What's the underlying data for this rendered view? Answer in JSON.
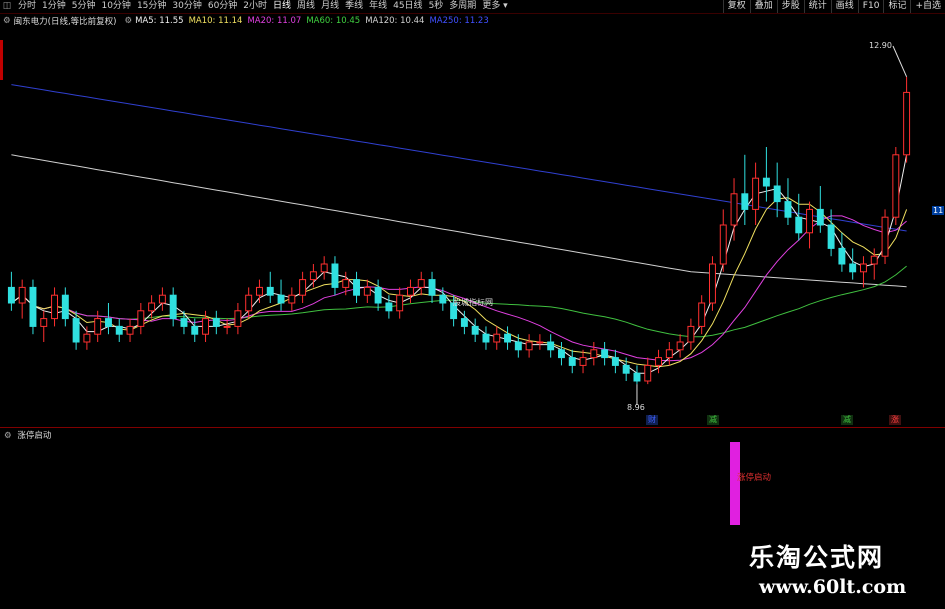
{
  "toolbar": {
    "icon": "chart-toggle-icon",
    "timeframes": [
      "分时",
      "1分钟",
      "5分钟",
      "10分钟",
      "15分钟",
      "30分钟",
      "60分钟",
      "2小时",
      "日线",
      "周线",
      "月线",
      "季线",
      "年线",
      "45日线",
      "5秒",
      "多周期",
      "更多"
    ],
    "active_index": 8,
    "right_buttons": [
      "复权",
      "叠加",
      "步股",
      "统计",
      "画线",
      "F10",
      "标记",
      "+自选"
    ]
  },
  "legend": {
    "title": "闽东电力(日线,等比前复权)",
    "ma5": "MA5: 11.55",
    "ma10": "MA10: 11.14",
    "ma20": "MA20: 11.07",
    "ma60": "MA60: 10.45",
    "ma120": "MA120: 10.44",
    "ma250": "MA250: 11.23"
  },
  "labels": {
    "high_price": "12.90",
    "low_price": "8.96",
    "last_price": "11",
    "mid_watermark": "股城指标网",
    "sub_title": "涨停启动",
    "signal_text": "涨停启动",
    "brand": "乐淘公式网",
    "brand_url": "www.60lt.com"
  },
  "events": [
    {
      "text": "财",
      "color": "#4060ff",
      "bg": "#102050",
      "left": 646
    },
    {
      "text": "减",
      "color": "#40c040",
      "bg": "#103010",
      "left": 707
    },
    {
      "text": "减",
      "color": "#40c040",
      "bg": "#103010",
      "left": 841
    },
    {
      "text": "涨",
      "color": "#ff4040",
      "bg": "#401010",
      "left": 889
    }
  ],
  "colors": {
    "up": "#ff3030",
    "down": "#30e0e0",
    "ma5": "#f0f0f0",
    "ma10": "#f0e060",
    "ma20": "#e040e0",
    "ma60": "#40c040",
    "ma120": "#d0d0d0",
    "ma250": "#3040d0"
  },
  "chart_data": {
    "type": "line",
    "title": "闽东电力(日线,等比前复权)",
    "xlabel": "",
    "ylabel": "",
    "ylim": [
      8.5,
      13.5
    ],
    "candles": [
      [
        10.2,
        10.4,
        9.9,
        10.0
      ],
      [
        10.0,
        10.3,
        9.8,
        10.2
      ],
      [
        10.2,
        10.3,
        9.6,
        9.7
      ],
      [
        9.7,
        9.9,
        9.5,
        9.8
      ],
      [
        9.8,
        10.2,
        9.7,
        10.1
      ],
      [
        10.1,
        10.2,
        9.7,
        9.8
      ],
      [
        9.8,
        9.9,
        9.4,
        9.5
      ],
      [
        9.5,
        9.7,
        9.4,
        9.6
      ],
      [
        9.6,
        9.9,
        9.5,
        9.8
      ],
      [
        9.8,
        10.0,
        9.6,
        9.7
      ],
      [
        9.7,
        9.8,
        9.5,
        9.6
      ],
      [
        9.6,
        9.8,
        9.5,
        9.7
      ],
      [
        9.7,
        10.0,
        9.6,
        9.9
      ],
      [
        9.9,
        10.1,
        9.8,
        10.0
      ],
      [
        10.0,
        10.2,
        9.9,
        10.1
      ],
      [
        10.1,
        10.2,
        9.7,
        9.8
      ],
      [
        9.8,
        9.9,
        9.6,
        9.7
      ],
      [
        9.7,
        9.8,
        9.5,
        9.6
      ],
      [
        9.6,
        9.9,
        9.5,
        9.8
      ],
      [
        9.8,
        9.9,
        9.6,
        9.7
      ],
      [
        9.7,
        9.8,
        9.6,
        9.7
      ],
      [
        9.7,
        10.0,
        9.6,
        9.9
      ],
      [
        9.9,
        10.2,
        9.8,
        10.1
      ],
      [
        10.1,
        10.3,
        10.0,
        10.2
      ],
      [
        10.2,
        10.4,
        10.0,
        10.1
      ],
      [
        10.1,
        10.3,
        9.9,
        10.0
      ],
      [
        10.0,
        10.2,
        9.9,
        10.1
      ],
      [
        10.1,
        10.4,
        10.0,
        10.3
      ],
      [
        10.3,
        10.5,
        10.2,
        10.4
      ],
      [
        10.4,
        10.6,
        10.3,
        10.5
      ],
      [
        10.5,
        10.6,
        10.1,
        10.2
      ],
      [
        10.2,
        10.4,
        10.1,
        10.3
      ],
      [
        10.3,
        10.4,
        10.0,
        10.1
      ],
      [
        10.1,
        10.3,
        10.0,
        10.2
      ],
      [
        10.2,
        10.3,
        9.9,
        10.0
      ],
      [
        10.0,
        10.1,
        9.8,
        9.9
      ],
      [
        9.9,
        10.2,
        9.8,
        10.1
      ],
      [
        10.1,
        10.3,
        10.0,
        10.2
      ],
      [
        10.2,
        10.4,
        10.1,
        10.3
      ],
      [
        10.3,
        10.4,
        10.0,
        10.1
      ],
      [
        10.1,
        10.2,
        9.9,
        10.0
      ],
      [
        10.0,
        10.1,
        9.7,
        9.8
      ],
      [
        9.8,
        9.9,
        9.6,
        9.7
      ],
      [
        9.7,
        9.8,
        9.5,
        9.6
      ],
      [
        9.6,
        9.7,
        9.4,
        9.5
      ],
      [
        9.5,
        9.7,
        9.4,
        9.6
      ],
      [
        9.6,
        9.7,
        9.4,
        9.5
      ],
      [
        9.5,
        9.6,
        9.3,
        9.4
      ],
      [
        9.4,
        9.6,
        9.3,
        9.5
      ],
      [
        9.5,
        9.6,
        9.4,
        9.5
      ],
      [
        9.5,
        9.6,
        9.3,
        9.4
      ],
      [
        9.4,
        9.5,
        9.2,
        9.3
      ],
      [
        9.3,
        9.4,
        9.1,
        9.2
      ],
      [
        9.2,
        9.4,
        9.1,
        9.3
      ],
      [
        9.3,
        9.5,
        9.2,
        9.4
      ],
      [
        9.4,
        9.5,
        9.2,
        9.3
      ],
      [
        9.3,
        9.4,
        9.1,
        9.2
      ],
      [
        9.2,
        9.3,
        9.0,
        9.1
      ],
      [
        9.1,
        9.2,
        8.96,
        9.0
      ],
      [
        9.0,
        9.3,
        8.96,
        9.2
      ],
      [
        9.2,
        9.4,
        9.1,
        9.3
      ],
      [
        9.3,
        9.5,
        9.2,
        9.4
      ],
      [
        9.4,
        9.6,
        9.3,
        9.5
      ],
      [
        9.5,
        9.8,
        9.4,
        9.7
      ],
      [
        9.7,
        10.1,
        9.6,
        10.0
      ],
      [
        10.0,
        10.6,
        9.9,
        10.5
      ],
      [
        10.5,
        11.2,
        10.4,
        11.0
      ],
      [
        11.0,
        11.6,
        10.8,
        11.4
      ],
      [
        11.4,
        11.9,
        11.0,
        11.2
      ],
      [
        11.2,
        11.8,
        11.0,
        11.6
      ],
      [
        11.6,
        12.0,
        11.3,
        11.5
      ],
      [
        11.5,
        11.8,
        11.1,
        11.3
      ],
      [
        11.3,
        11.6,
        11.0,
        11.1
      ],
      [
        11.1,
        11.4,
        10.8,
        10.9
      ],
      [
        10.9,
        11.3,
        10.7,
        11.2
      ],
      [
        11.2,
        11.5,
        10.9,
        11.0
      ],
      [
        11.0,
        11.2,
        10.6,
        10.7
      ],
      [
        10.7,
        10.9,
        10.4,
        10.5
      ],
      [
        10.5,
        10.7,
        10.3,
        10.4
      ],
      [
        10.4,
        10.6,
        10.2,
        10.5
      ],
      [
        10.5,
        10.7,
        10.3,
        10.6
      ],
      [
        10.6,
        11.2,
        10.5,
        11.1
      ],
      [
        11.1,
        12.0,
        11.0,
        11.9
      ],
      [
        11.9,
        12.9,
        11.8,
        12.7
      ]
    ]
  }
}
